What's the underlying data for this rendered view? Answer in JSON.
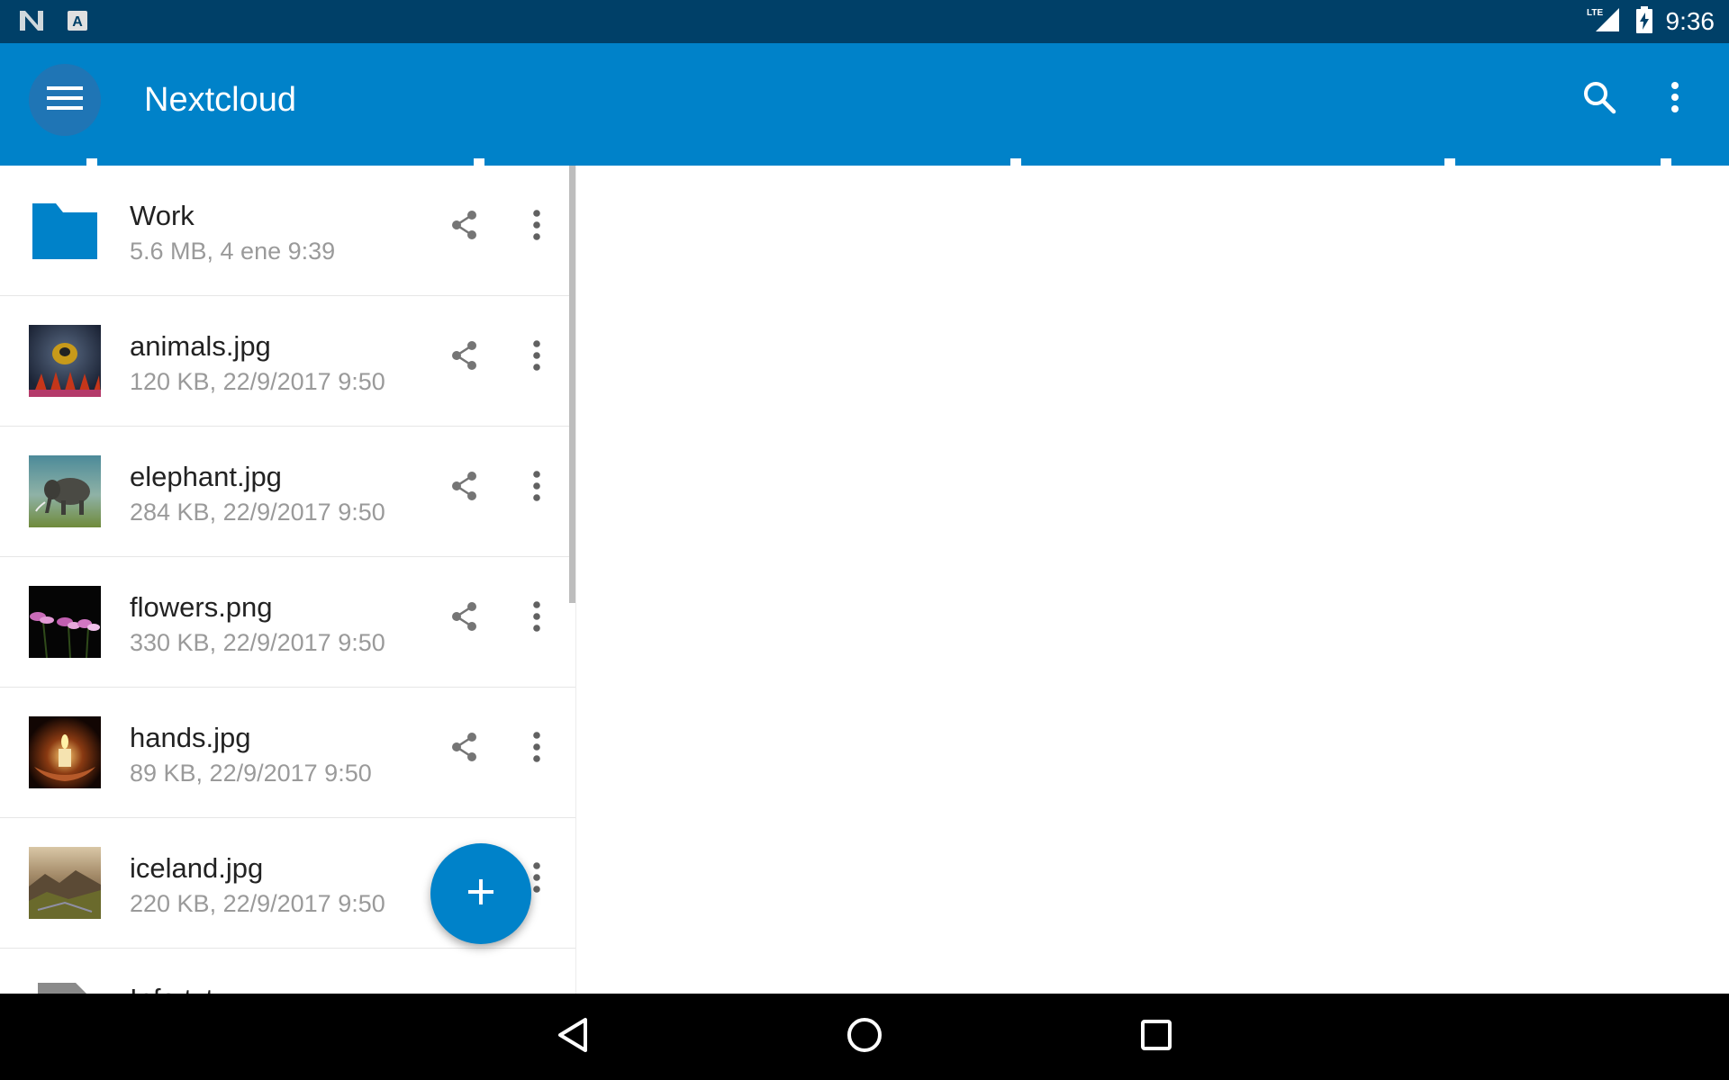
{
  "status_bar": {
    "time": "9:36",
    "network": "LTE",
    "left_icons": [
      "n-icon",
      "a-notification-icon"
    ],
    "right_icons": [
      "signal-icon",
      "battery-charging-icon"
    ]
  },
  "app_bar": {
    "title": "Nextcloud",
    "color": "#0082c9",
    "icons": [
      "menu-icon",
      "search-icon",
      "more-vert-icon"
    ]
  },
  "files": [
    {
      "name": "Work",
      "meta": "5.6 MB, 4 ene 9:39",
      "icon": "folder-icon"
    },
    {
      "name": "animals.jpg",
      "meta": "120 KB, 22/9/2017 9:50",
      "icon": "image-thumbnail"
    },
    {
      "name": "elephant.jpg",
      "meta": "284 KB, 22/9/2017 9:50",
      "icon": "image-thumbnail"
    },
    {
      "name": "flowers.png",
      "meta": "330 KB, 22/9/2017 9:50",
      "icon": "image-thumbnail"
    },
    {
      "name": "hands.jpg",
      "meta": "89 KB, 22/9/2017 9:50",
      "icon": "image-thumbnail"
    },
    {
      "name": "iceland.jpg",
      "meta": "220 KB, 22/9/2017 9:50",
      "icon": "image-thumbnail"
    },
    {
      "name": "Info.txt",
      "meta": "",
      "icon": "text-file-icon"
    }
  ],
  "fab": {
    "icon": "plus-icon"
  },
  "nav_bar": {
    "icons": [
      "back-icon",
      "home-icon",
      "recents-icon"
    ]
  }
}
